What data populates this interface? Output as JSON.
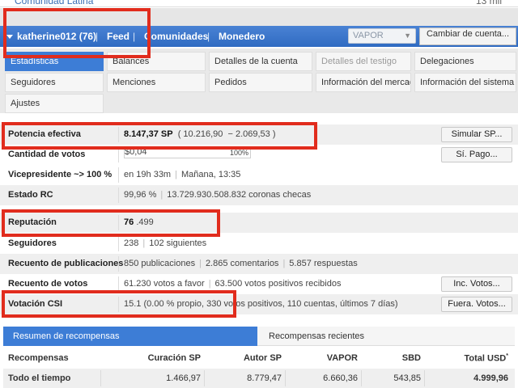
{
  "community": {
    "label": "Comunidad Latina",
    "count": "13 mil"
  },
  "navbar": {
    "user": "katherine012 (76)",
    "items": [
      "Feed",
      "Comunidades",
      "Monedero"
    ],
    "currency": "VAPOR",
    "change_account": "Cambiar de cuenta..."
  },
  "tabs": [
    "Estadísticas",
    "Balances",
    "Detalles de la cuenta",
    "Detalles del testigo",
    "Delegaciones",
    "Seguidores",
    "Menciones",
    "Pedidos",
    "Información del mercado",
    "Información del sistema",
    "Ajustes"
  ],
  "stats": {
    "potencia": {
      "label": "Potencia efectiva",
      "value": "8.147,37 SP",
      "detail_open": "(",
      "detail_a": "10.216,90",
      "detail_b": "− 2.069,53",
      "detail_close": ")",
      "button": "Simular SP..."
    },
    "votos": {
      "label": "Cantidad de votos",
      "value": "$0,04",
      "percent": "100%",
      "button": "Sí. Pago..."
    },
    "vicepresidente": {
      "label": "Vicepresidente ~> 100 %",
      "value": "en 19h 33m",
      "detail": "Mañana, 13:35"
    },
    "rc": {
      "label": "Estado RC",
      "value": "99,96 %",
      "detail": "13.729.930.508.832 coronas checas"
    },
    "reputacion": {
      "label": "Reputación",
      "value": "76",
      "decimals": ".499"
    },
    "seguidores": {
      "label": "Seguidores",
      "value": "238",
      "detail": "102 siguientes"
    },
    "publicaciones": {
      "label": "Recuento de publicaciones",
      "value": "850 publicaciones",
      "detail": "2.865 comentarios",
      "detail2": "5.857 respuestas"
    },
    "recuento_votos": {
      "label": "Recuento de votos",
      "value": "61.230 votos a favor",
      "detail": "63.500 votos positivos recibidos",
      "button": "Inc. Votos..."
    },
    "csi": {
      "label": "Votación CSI",
      "value": "15.1",
      "detail": "(0.00 % propio, 330 votos positivos, 110 cuentas, últimos 7 días)",
      "button": "Fuera. Votos..."
    }
  },
  "rewards": {
    "tabs": [
      "Resumen de recompensas",
      "Recompensas recientes"
    ],
    "headers": [
      "Recompensas",
      "Curación SP",
      "Autor SP",
      "VAPOR",
      "SBD",
      "Total USD",
      "*"
    ],
    "row": [
      "Todo el tiempo",
      "1.466,97",
      "8.779,47",
      "6.660,36",
      "543,85",
      "4.999,96"
    ]
  },
  "colors": {
    "navbar": "#3f78cc",
    "active_tab": "#3d7dd6",
    "highlight": "#e12c1d"
  }
}
